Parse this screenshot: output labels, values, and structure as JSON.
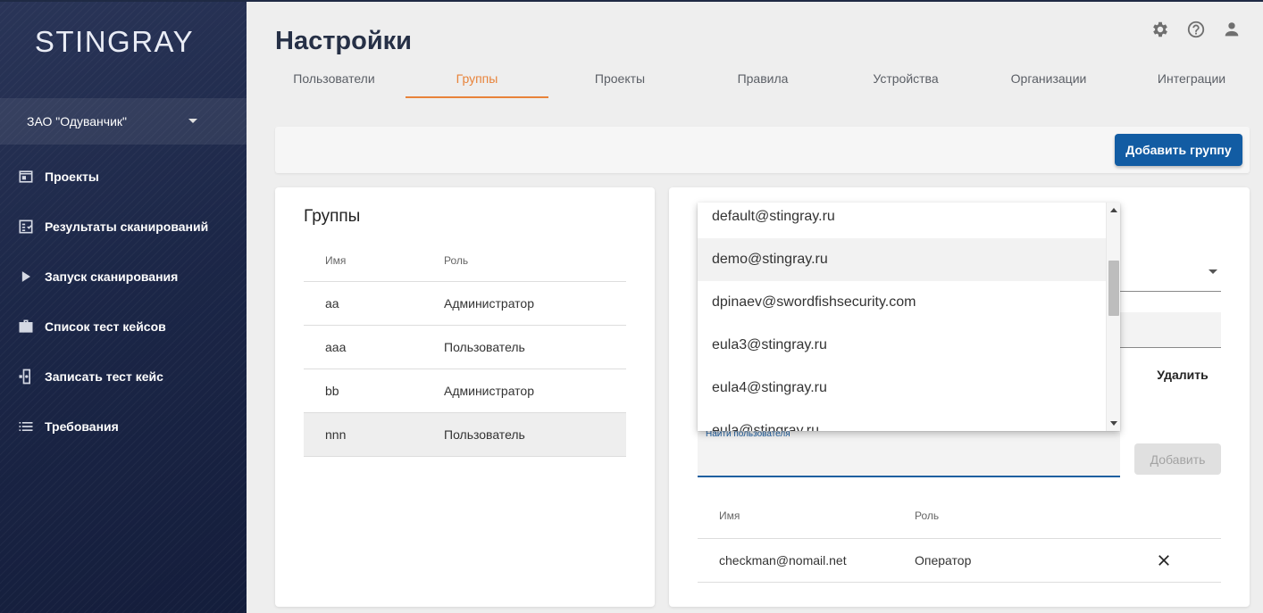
{
  "sidebar": {
    "logo": "STINGRAY",
    "org": "ЗАО \"Одуванчик\"",
    "items": [
      {
        "label": "Проекты",
        "icon": "projects-icon"
      },
      {
        "label": "Результаты сканирований",
        "icon": "scan-results-icon"
      },
      {
        "label": "Запуск сканирования",
        "icon": "play-icon"
      },
      {
        "label": "Список тест кейсов",
        "icon": "briefcase-icon"
      },
      {
        "label": "Записать тест кейс",
        "icon": "record-device-icon"
      },
      {
        "label": "Требования",
        "icon": "list-icon"
      }
    ]
  },
  "header": {
    "title": "Настройки",
    "icons": [
      "gear-icon",
      "help-icon",
      "account-icon"
    ]
  },
  "tabs": [
    "Пользователи",
    "Группы",
    "Проекты",
    "Правила",
    "Устройства",
    "Организации",
    "Интеграции"
  ],
  "active_tab": "Группы",
  "toolbar": {
    "add_group": "Добавить группу"
  },
  "groups": {
    "title": "Группы",
    "columns": [
      "Имя",
      "Роль"
    ],
    "rows": [
      {
        "name": "aa",
        "role": "Администратор"
      },
      {
        "name": "aaa",
        "role": "Пользователь"
      },
      {
        "name": "bb",
        "role": "Администратор"
      },
      {
        "name": "nnn",
        "role": "Пользователь"
      }
    ],
    "selected": "nnn"
  },
  "detail": {
    "delete_label": "Удалить",
    "partial_glyph": "›",
    "search_label": "Найти пользователя",
    "search_value": "",
    "add_label": "Добавить",
    "members_columns": [
      "Имя",
      "Роль"
    ],
    "members": [
      {
        "name": "checkman@nomail.net",
        "role": "Оператор"
      }
    ]
  },
  "dropdown": {
    "options": [
      "default@stingray.ru",
      "demo@stingray.ru",
      "dpinaev@swordfishsecurity.com",
      "eula3@stingray.ru",
      "eula4@stingray.ru",
      "eula@stingray.ru"
    ],
    "hovered": "demo@stingray.ru"
  },
  "colors": {
    "accent": "#e8833a",
    "primary": "#125ca3",
    "sidebar": "#1c2748"
  }
}
